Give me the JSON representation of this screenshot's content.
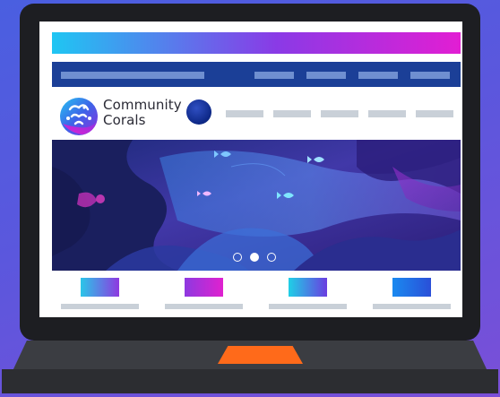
{
  "brand": {
    "line1": "Community",
    "line2": "Corals"
  },
  "hero": {
    "active_slide": 2,
    "slide_count": 3
  },
  "colors": {
    "background": "#5b57dd",
    "nav_bar": "#1b3f97",
    "trackpad": "#ff6a1a",
    "placeholder_gray": "#c9d0d8",
    "top_gradient": [
      "#1fc6f3",
      "#8a3ae6",
      "#e21ed3"
    ]
  },
  "icons": {
    "logo": "coral-logo-icon",
    "fish": "fish-icon",
    "profile": "avatar"
  }
}
